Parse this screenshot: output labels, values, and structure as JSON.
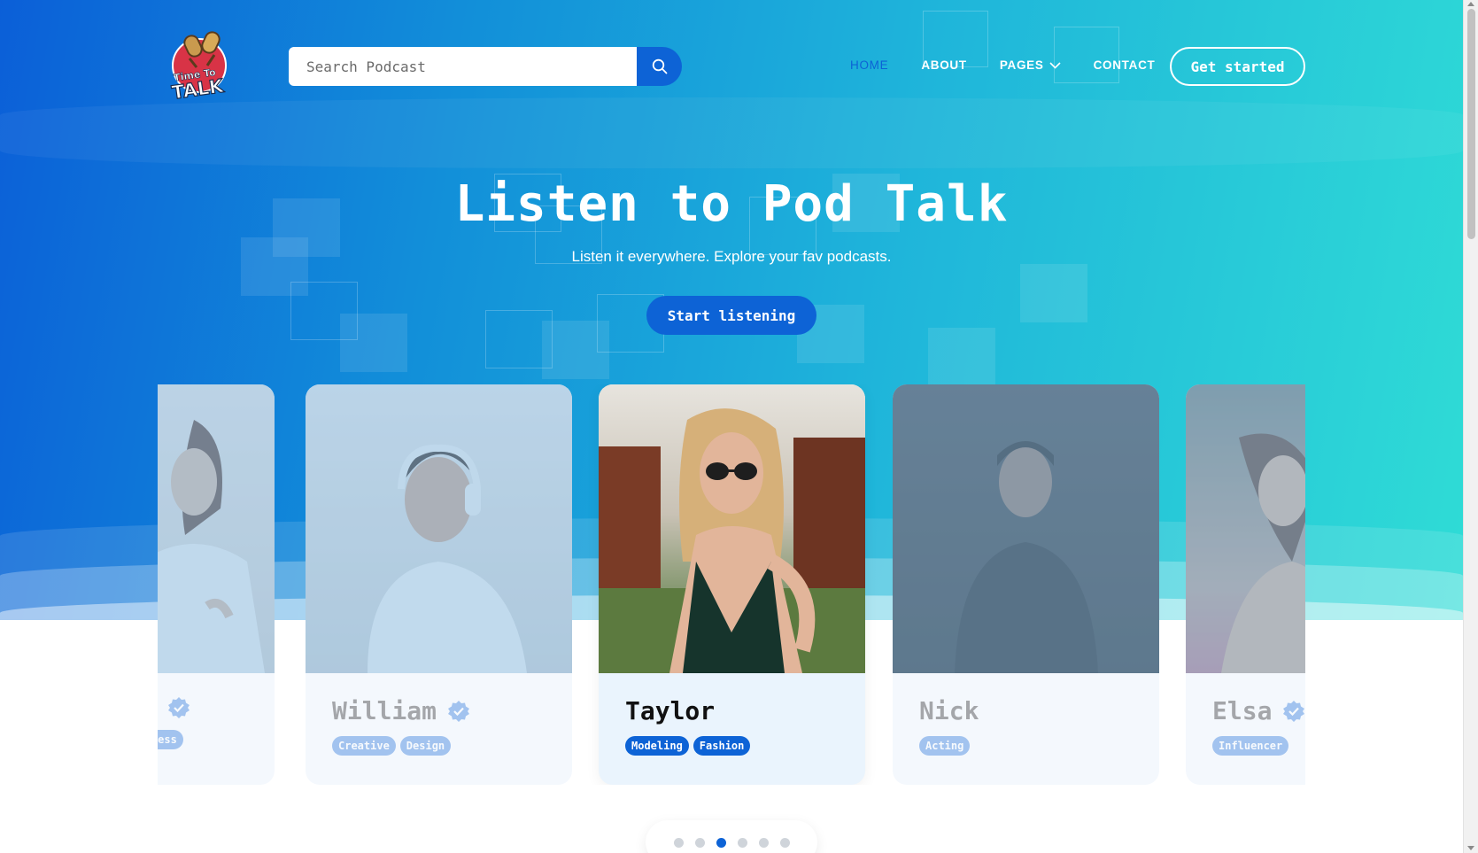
{
  "brand": {
    "logo_text_top": "Time To",
    "logo_text_bottom": "TALK"
  },
  "search": {
    "placeholder": "Search Podcast",
    "value": ""
  },
  "nav": {
    "items": [
      {
        "label": "HOME",
        "active": true
      },
      {
        "label": "ABOUT",
        "active": false
      },
      {
        "label": "PAGES",
        "active": false,
        "dropdown": true
      },
      {
        "label": "CONTACT",
        "active": false
      }
    ],
    "cta_label": "Get started"
  },
  "hero": {
    "title": "Listen to Pod Talk",
    "subtitle": "Listen it everywhere. Explore your fav podcasts.",
    "cta_label": "Start listening"
  },
  "cards": [
    {
      "name": "",
      "verified": true,
      "tags": [
        "Business"
      ],
      "active": false
    },
    {
      "name": "William",
      "verified": true,
      "tags": [
        "Creative",
        "Design"
      ],
      "active": false
    },
    {
      "name": "Taylor",
      "verified": false,
      "tags": [
        "Modeling",
        "Fashion"
      ],
      "active": true
    },
    {
      "name": "Nick",
      "verified": false,
      "tags": [
        "Acting"
      ],
      "active": false
    },
    {
      "name": "Elsa",
      "verified": true,
      "tags": [
        "Influencer"
      ],
      "active": false
    }
  ],
  "pagination": {
    "count": 6,
    "active_index": 2
  },
  "colors": {
    "accent": "#0d63d6",
    "hero_start": "#0b5fd8",
    "hero_end": "#2fdcd6"
  },
  "icons": {
    "search": "search-icon",
    "dropdown": "chevron-down-icon",
    "verified": "verified-badge-icon"
  }
}
